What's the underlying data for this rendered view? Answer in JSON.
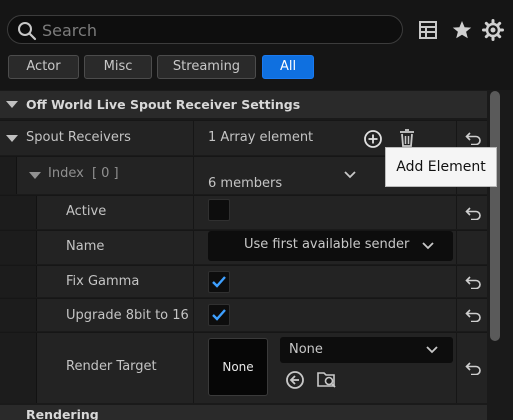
{
  "search": {
    "placeholder": "Search",
    "value": ""
  },
  "toolbar": {
    "icons": [
      "table-icon",
      "star-icon",
      "gear-icon"
    ]
  },
  "filters": [
    {
      "label": "Actor",
      "active": false
    },
    {
      "label": "Misc",
      "active": false
    },
    {
      "label": "Streaming",
      "active": false
    },
    {
      "label": "All",
      "active": true
    }
  ],
  "section": {
    "title": "Off World Live Spout Receiver Settings"
  },
  "spout_receivers": {
    "label": "Spout Receivers",
    "value": "1 Array element"
  },
  "index_row": {
    "label": "Index",
    "index": "[ 0 ]",
    "value": "6 members"
  },
  "properties": {
    "active": {
      "label": "Active",
      "checked": false
    },
    "name": {
      "label": "Name",
      "value": "Use first available sender"
    },
    "fix_gamma": {
      "label": "Fix Gamma",
      "checked": true
    },
    "upgrade": {
      "label": "Upgrade 8bit to 16",
      "checked": true
    },
    "render_target": {
      "label": "Render Target",
      "thumb": "None",
      "value": "None"
    }
  },
  "tooltip": {
    "text": "Add Element"
  },
  "next_section": {
    "title": "Rendering"
  },
  "colors": {
    "accent": "#0f70e0",
    "check": "#3ea0ff"
  }
}
